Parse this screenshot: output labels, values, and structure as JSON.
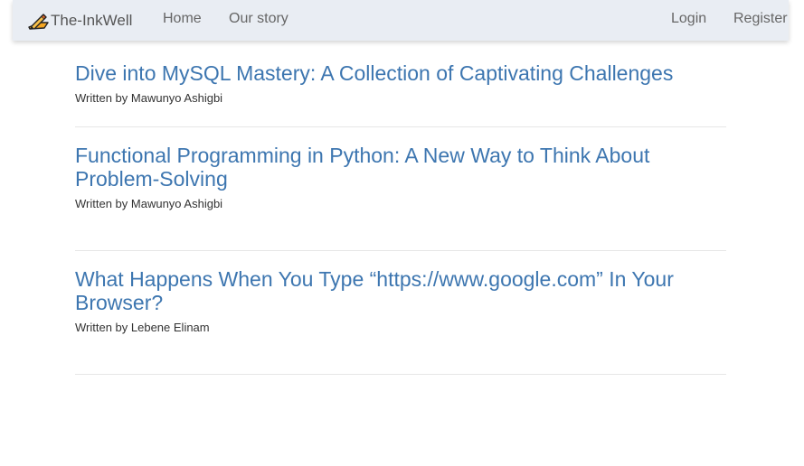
{
  "navbar": {
    "brand": {
      "icon": "pencil-writing-icon",
      "label": "The-InkWell"
    },
    "links": {
      "home": "Home",
      "our_story": "Our story",
      "login": "Login",
      "register": "Register"
    }
  },
  "posts": [
    {
      "title": "Dive into MySQL Mastery: A Collection of Captivating Challenges",
      "byline": "Written by Mawunyo Ashigbi"
    },
    {
      "title": "Functional Programming in Python: A New Way to Think About Problem-Solving",
      "byline": "Written by Mawunyo Ashigbi"
    },
    {
      "title": "What Happens When You Type “https://www.google.com” In Your Browser?",
      "byline": "Written by Lebene Elinam"
    }
  ],
  "colors": {
    "navbar_bg": "#e9edf3",
    "link_title": "#3d76b0",
    "brand_accent": "#f5a623"
  }
}
